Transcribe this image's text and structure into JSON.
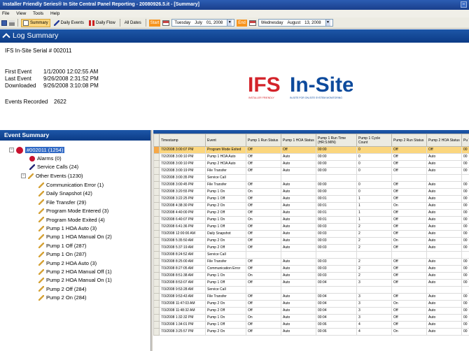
{
  "window": {
    "title": "Installer Friendly Series® In Site Central Panel Reporting - 20080926.5.it - [Summary]",
    "controls_icon": "window-restore-icon"
  },
  "menu": [
    "File",
    "View",
    "Tools",
    "Help"
  ],
  "toolbar": {
    "buttons": [
      {
        "label": "Summary",
        "icon": "summary-icon",
        "active": true
      },
      {
        "label": "Daily Events",
        "icon": "pencil-icon",
        "active": false
      },
      {
        "label": "Daily Flow",
        "icon": "chart-icon",
        "active": false
      },
      {
        "label": "All Dates",
        "icon": "",
        "active": false
      }
    ],
    "start_label": "Start",
    "start_date": {
      "weekday": "Tuesday",
      "month": "July",
      "day": "01, 2008"
    },
    "end_label": "End",
    "end_date": {
      "weekday": "Wednesday",
      "month": "August",
      "day": "13, 2008"
    }
  },
  "log_summary": {
    "header": "Log Summary",
    "serial": "IFS In-Site Serial # 002011",
    "first_event_label": "First Event",
    "first_event": "1/1/2000 12:02:55 AM",
    "last_event_label": "Last Event",
    "last_event": "9/26/2008 2:31:52 PM",
    "downloaded_label": "Downloaded",
    "downloaded": "9/26/2008 3:10:08 PM",
    "events_recorded_label": "Events Recorded",
    "events_recorded": "2622"
  },
  "logo": {
    "ifs": "IFS",
    "insite": "In-Site",
    "tag_left": "INSTALLER FRIENDLY",
    "tag_right": "IN-SITE FOR ON-SITE SYSTEM MONITORING"
  },
  "event_summary": {
    "header": "Event Summary",
    "root": "#002011 (1254)",
    "alarms": "Alarms (0)",
    "service_calls": "Service Calls (24)",
    "other_events": "Other Events (1230)",
    "children": [
      "Communication Error (1)",
      "Daily Snapshot (42)",
      "File Transfer (29)",
      "Program Mode Entered (3)",
      "Program Mode Exited (4)",
      "Pump 1 HOA Auto (3)",
      "Pump 1 HOA Manual On (2)",
      "Pump 1 Off (287)",
      "Pump 1 On (287)",
      "Pump 2 HOA Auto (3)",
      "Pump 2 HOA Manual Off (1)",
      "Pump 2 HOA Manual On (1)",
      "Pump 2 Off (284)",
      "Pump 2 On (284)"
    ]
  },
  "grid": {
    "columns": [
      "Timestamp",
      "Event",
      "Pump 1 Run Status",
      "Pump 1 HOA Status",
      "Pump 1 Run Time (HR:S:MIN)",
      "Pump 1 Cycle Count",
      "Pump 2 Run Status",
      "Pump 2 HOA Status",
      "Pu Te"
    ],
    "rows": [
      [
        "7/2/2008 3:00:07 PM",
        "Program Mode Exited",
        "Off",
        "Off",
        "00:00",
        "0",
        "Off",
        "Off",
        "00"
      ],
      [
        "7/2/2008 3:00:10 PM",
        "Pump 1 HOA Auto",
        "Off",
        "Auto",
        "00:00",
        "0",
        "Off",
        "Auto",
        "00"
      ],
      [
        "7/2/2008 3:00:10 PM",
        "Pump 2 HOA Auto",
        "Off",
        "Auto",
        "00:00",
        "0",
        "Off",
        "Auto",
        "00"
      ],
      [
        "7/2/2008 3:00:19 PM",
        "File Transfer",
        "Off",
        "Auto",
        "00:00",
        "0",
        "Off",
        "Auto",
        "00"
      ],
      [
        "7/2/2008 3:00:35 PM",
        "Service Call",
        "",
        "",
        "",
        "",
        "",
        "",
        ""
      ],
      [
        "7/2/2008 3:00:45 PM",
        "File Transfer",
        "Off",
        "Auto",
        "00:00",
        "0",
        "Off",
        "Auto",
        "00"
      ],
      [
        "7/2/2008 3:20:55 PM",
        "Pump 1 On",
        "On",
        "Auto",
        "00:00",
        "0",
        "Off",
        "Auto",
        "00"
      ],
      [
        "7/2/2008 3:22:25 PM",
        "Pump 1 Off",
        "Off",
        "Auto",
        "00:01",
        "1",
        "Off",
        "Auto",
        "00"
      ],
      [
        "7/2/2008 4:38:30 PM",
        "Pump 2 On",
        "Off",
        "Auto",
        "00:01",
        "1",
        "On",
        "Auto",
        "00"
      ],
      [
        "7/2/2008 4:40:00 PM",
        "Pump 2 Off",
        "Off",
        "Auto",
        "00:01",
        "1",
        "Off",
        "Auto",
        "00"
      ],
      [
        "7/2/2008 6:40:07 PM",
        "Pump 1 On",
        "On",
        "Auto",
        "00:01",
        "1",
        "Off",
        "Auto",
        "00"
      ],
      [
        "7/2/2008 6:41:36 PM",
        "Pump 1 Off",
        "Off",
        "Auto",
        "00:03",
        "2",
        "Off",
        "Auto",
        "00"
      ],
      [
        "7/3/2008 12:00:00 AM",
        "Daily Snapshot",
        "Off",
        "Auto",
        "00:03",
        "2",
        "Off",
        "Auto",
        "00"
      ],
      [
        "7/3/2008 5:35:50 AM",
        "Pump 2 On",
        "Off",
        "Auto",
        "00:03",
        "2",
        "On",
        "Auto",
        "00"
      ],
      [
        "7/3/2008 5:37:19 AM",
        "Pump 2 Off",
        "Off",
        "Auto",
        "00:03",
        "2",
        "Off",
        "Auto",
        "00"
      ],
      [
        "7/3/2008 8:24:52 AM",
        "Service Call",
        "",
        "",
        "",
        "",
        "",
        "",
        ""
      ],
      [
        "7/3/2008 8:25:00 AM",
        "File Transfer",
        "Off",
        "Auto",
        "00:03",
        "2",
        "Off",
        "Auto",
        "00"
      ],
      [
        "7/3/2008 8:27:05 AM",
        "Communication Error",
        "Off",
        "Auto",
        "00:03",
        "2",
        "Off",
        "Auto",
        "00"
      ],
      [
        "7/3/2008 8:51:38 AM",
        "Pump 1 On",
        "On",
        "Auto",
        "00:03",
        "2",
        "Off",
        "Auto",
        "00"
      ],
      [
        "7/3/2008 8:53:07 AM",
        "Pump 1 Off",
        "Off",
        "Auto",
        "00:04",
        "3",
        "Off",
        "Auto",
        "00"
      ],
      [
        "7/3/2008 9:53:28 AM",
        "Service Call",
        "",
        "",
        "",
        "",
        "",
        "",
        ""
      ],
      [
        "7/3/2008 9:53:43 AM",
        "File Transfer",
        "Off",
        "Auto",
        "00:04",
        "3",
        "Off",
        "Auto",
        "00"
      ],
      [
        "7/3/2008 11:47:03 AM",
        "Pump 2 On",
        "Off",
        "Auto",
        "00:04",
        "3",
        "On",
        "Auto",
        "00"
      ],
      [
        "7/3/2008 11:48:32 AM",
        "Pump 2 Off",
        "Off",
        "Auto",
        "00:04",
        "3",
        "Off",
        "Auto",
        "00"
      ],
      [
        "7/3/2008 1:32:32 PM",
        "Pump 1 On",
        "On",
        "Auto",
        "00:04",
        "3",
        "Off",
        "Auto",
        "00"
      ],
      [
        "7/3/2008 1:34:01 PM",
        "Pump 1 Off",
        "Off",
        "Auto",
        "00:06",
        "4",
        "Off",
        "Auto",
        "00"
      ],
      [
        "7/3/2008 3:25:57 PM",
        "Pump 2 On",
        "Off",
        "Auto",
        "00:06",
        "4",
        "On",
        "Auto",
        "00"
      ]
    ]
  },
  "colors": {
    "header_blue": "#0c3b86",
    "ifs_red": "#d3232a",
    "insite_blue": "#0d4a9c",
    "selection_orange": "#fbd67e",
    "active_button": "#fbd67e",
    "date_tag": "#f7941d"
  }
}
